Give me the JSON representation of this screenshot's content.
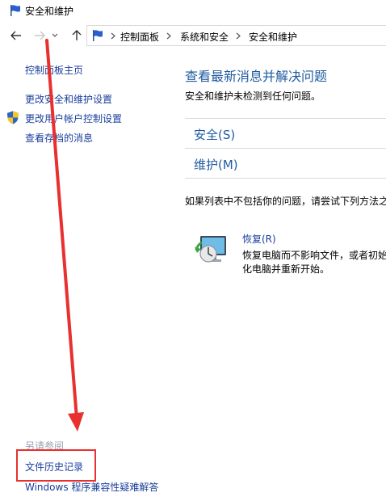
{
  "window": {
    "title": "安全和维护"
  },
  "address_bar": {
    "crumbs": [
      "控制面板",
      "系统和安全",
      "安全和维护"
    ]
  },
  "left_pane": {
    "home": "控制面板主页",
    "links": [
      "更改安全和维护设置",
      "更改用户帐户控制设置",
      "查看存档的消息"
    ],
    "see_also_heading": "另请参阅",
    "see_also": [
      "文件历史记录",
      "Windows 程序兼容性疑难解答"
    ]
  },
  "main": {
    "title": "查看最新消息并解决问题",
    "subtitle": "安全和维护未检测到任何问题。",
    "sections": [
      "安全(S)",
      "维护(M)"
    ],
    "notice": "如果列表中不包括你的问题，请尝试下列方法之",
    "recovery": {
      "title": "恢复(R)",
      "desc_line1": "恢复电脑而不影响文件，或者初始",
      "desc_line2": "化电脑并重新开始。"
    }
  },
  "colors": {
    "link": "#1a3e9c",
    "heading": "#1e5a9f",
    "annotation": "#e8302f"
  },
  "icons": [
    "flag-icon",
    "back-arrow-icon",
    "forward-arrow-icon",
    "dropdown-chevron-icon",
    "up-arrow-icon",
    "shield-icon",
    "recovery-icon"
  ]
}
